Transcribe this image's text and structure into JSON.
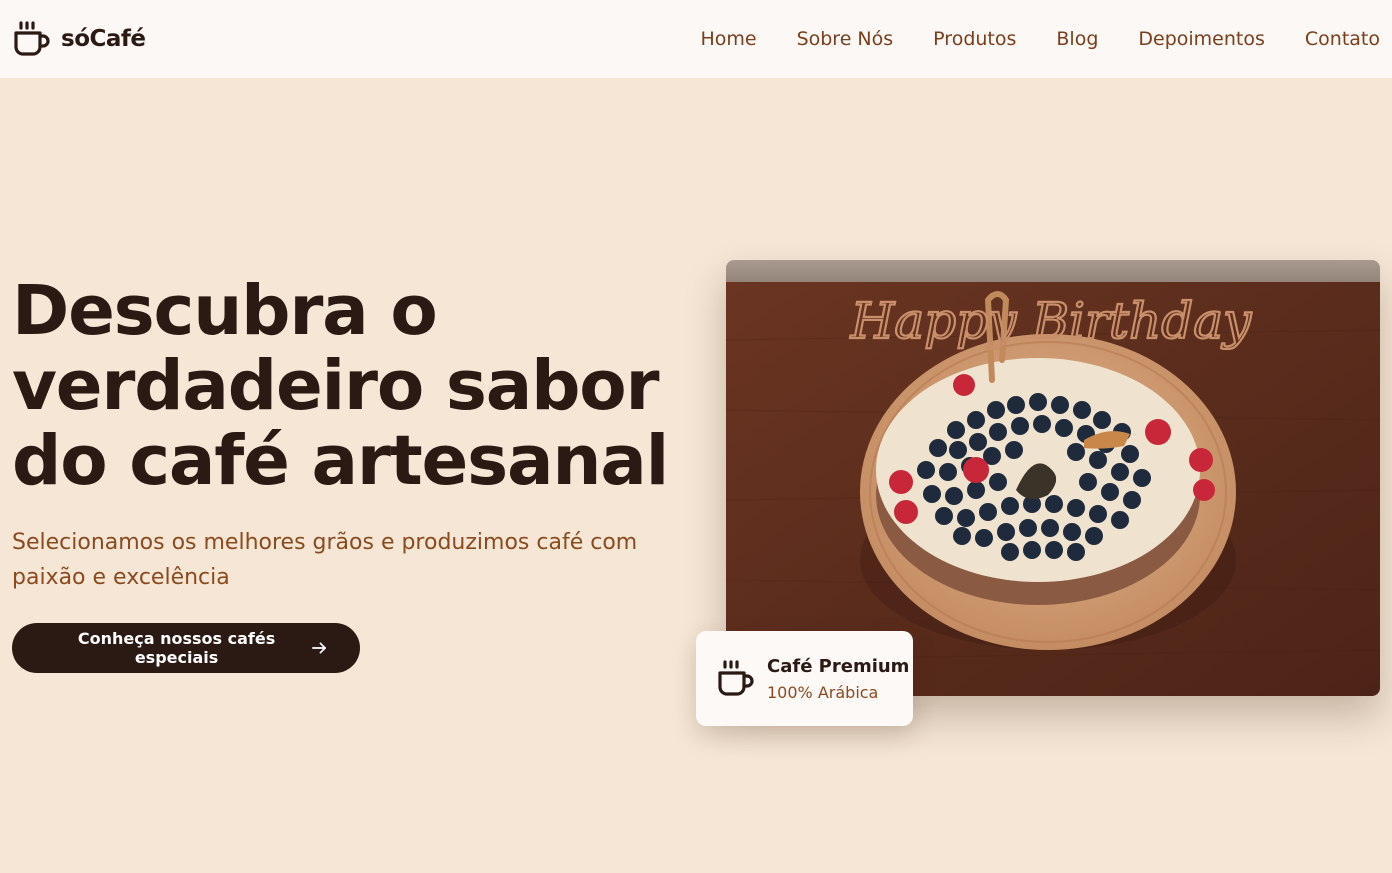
{
  "brand": {
    "name": "sóCafé",
    "icon": "coffee-cup-icon"
  },
  "nav": {
    "items": [
      "Home",
      "Sobre Nós",
      "Produtos",
      "Blog",
      "Depoimentos",
      "Contato"
    ]
  },
  "hero": {
    "title_line1": "Descubra o",
    "title_line2": "verdadeiro sabor",
    "title_line3": "do café artesanal",
    "subtitle": "Selecionamos os melhores grãos e produzimos café com paixão e excelência",
    "cta_label": "Conheça nossos cafés especiais",
    "cta_icon": "arrow-right-icon"
  },
  "badge": {
    "icon": "coffee-cup-icon",
    "title": "Café Premium",
    "subtitle": "100% Arábica"
  },
  "image": {
    "topper_text": "Happy Birthday"
  },
  "colors": {
    "background": "#f5e6d5",
    "header_bg": "#fcf8f5",
    "dark_brown": "#2b1914",
    "accent_brown": "#8b4a1f"
  }
}
